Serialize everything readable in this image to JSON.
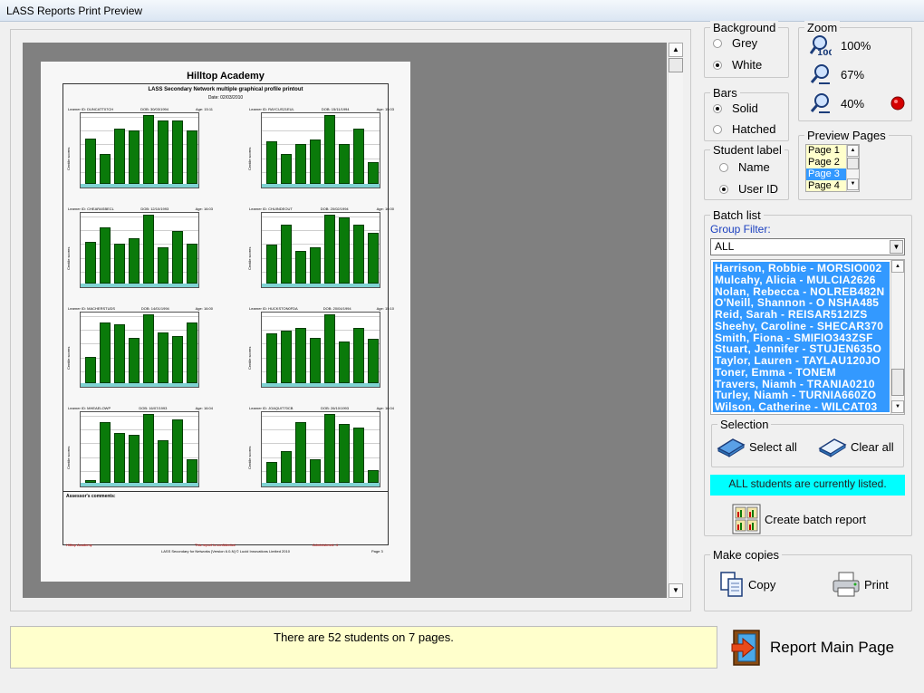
{
  "window": {
    "title": "LASS Reports Print Preview"
  },
  "preview": {
    "school": "Hilltop Academy",
    "subtitle": "LASS Secondary Network multiple graphical profile printout",
    "date": "Date: 02/03/2010",
    "comments_label": "Assessor's comments:",
    "footer_left": "Hilltop Academy",
    "footer_mid": "This report is confidential",
    "footer_right": "Administered: 4",
    "footer": "LASS Secondary for Networks [Version 6.0-N] © Lucid Innovations Limited 2010",
    "page_label": "Page 3",
    "y_axis_label": "Centile scores",
    "charts": [
      {
        "user": "Learner ID: DUNCATT07CH",
        "dob": "DOB: 30/03/1994",
        "age": "Age: 15:11",
        "values": [
          66,
          44,
          80,
          78,
          100,
          92,
          92,
          78
        ]
      },
      {
        "user": "Learner ID: RAYCUS21EUL",
        "dob": "DOB: 15/11/1994",
        "age": "Age: 15:03",
        "values": [
          62,
          44,
          58,
          64,
          100,
          58,
          80,
          32
        ]
      },
      {
        "user": "Learner ID: CHEARASBECL",
        "dob": "DOB: 12/10/1993",
        "age": "Age: 16:03",
        "values": [
          60,
          82,
          58,
          66,
          100,
          52,
          76,
          58
        ]
      },
      {
        "user": "Learner ID: CHUINDEOUT",
        "dob": "DOB: 20/02/1994",
        "age": "Age: 16:00",
        "values": [
          56,
          86,
          48,
          52,
          100,
          96,
          86,
          74
        ]
      },
      {
        "user": "Learner ID: MACHERSTUDS",
        "dob": "DOB: 14/01/1994",
        "age": "Age: 16:00",
        "values": [
          38,
          88,
          86,
          66,
          100,
          74,
          68,
          88
        ]
      },
      {
        "user": "Learner ID: HUCKSTON0FDA",
        "dob": "DOB: 20/04/1994",
        "age": "Age: 15:10",
        "values": [
          72,
          76,
          80,
          66,
          100,
          60,
          80,
          64
        ]
      },
      {
        "user": "Learner ID: MHEAELOWP",
        "dob": "DOB: 16/07/1993",
        "age": "Age: 16:04",
        "values": [
          4,
          88,
          72,
          70,
          100,
          62,
          92,
          34
        ]
      },
      {
        "user": "Learner ID: JOAQUIT70CB",
        "dob": "DOB: 26/10/1993",
        "age": "Age: 16:04",
        "values": [
          30,
          46,
          88,
          34,
          100,
          86,
          80,
          18
        ]
      }
    ]
  },
  "background": {
    "label": "Background",
    "options": [
      "Grey",
      "White"
    ],
    "selected": "White"
  },
  "bars": {
    "label": "Bars",
    "options": [
      "Solid",
      "Hatched"
    ],
    "selected": "Solid"
  },
  "student_label": {
    "label": "Student label",
    "options": [
      "Name",
      "User ID"
    ],
    "selected": "User ID"
  },
  "zoom": {
    "label": "Zoom",
    "levels": [
      "100%",
      "67%",
      "40%"
    ],
    "active": "40%"
  },
  "preview_pages": {
    "label": "Preview Pages",
    "items": [
      "Page 1",
      "Page 2",
      "Page 3",
      "Page 4"
    ],
    "selected": "Page 3"
  },
  "batch": {
    "label": "Batch list",
    "group_filter_label": "Group Filter:",
    "group_filter_value": "ALL",
    "items": [
      "Harrison, Robbie - MORSIO002",
      "Mulcahy, Alicia - MULCIA2626",
      "Nolan, Rebecca - NOLREB482N",
      "O'Neill, Shannon - O NSHA485",
      "Reid, Sarah - REISAR512IZS",
      "Sheehy, Caroline - SHECAR370",
      "Smith, Fiona - SMIFIO343ZSF",
      "Stuart, Jennifer - STUJEN635O",
      "Taylor, Lauren - TAYLAU120JO",
      "Toner, Emma - TONEM",
      "Travers, Niamh - TRANIA0210",
      "Turley, Niamh - TURNIA660ZO",
      "Wilson, Catherine - WILCAT03"
    ],
    "selection_label": "Selection",
    "select_all": "Select all",
    "clear_all": "Clear all",
    "info": "ALL students are currently listed.",
    "create_batch": "Create batch report"
  },
  "copies": {
    "label": "Make copies",
    "copy": "Copy",
    "print": "Print"
  },
  "status": "There are 52 students on 7 pages.",
  "report_main": "Report Main Page",
  "colors": {
    "bar": "#0a7a0a",
    "highlight": "#3399ff",
    "info": "#00ffff",
    "status": "#ffffcc"
  }
}
